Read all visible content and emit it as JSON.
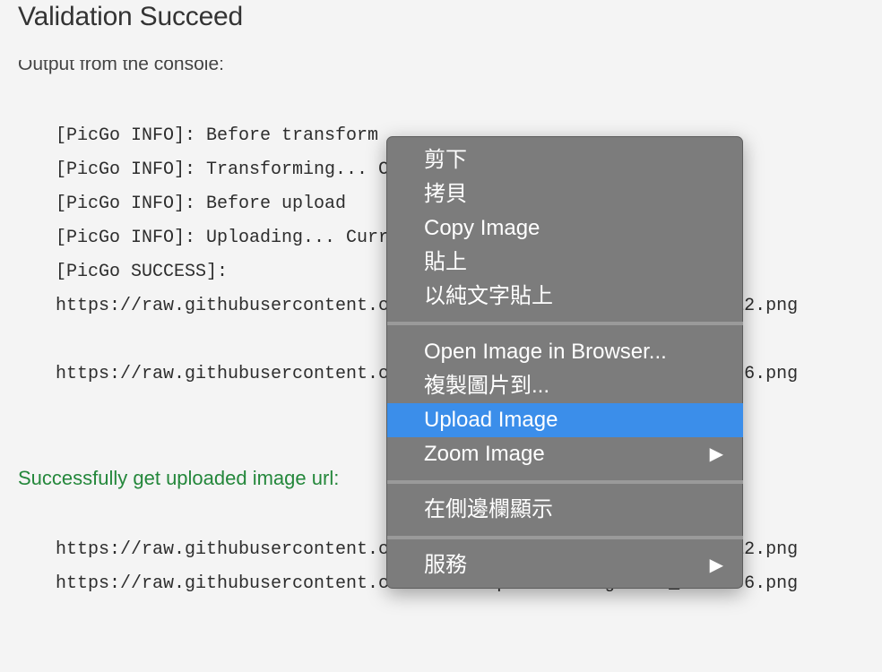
{
  "page": {
    "title": "Validation Succeed",
    "console_label": "Output from the console:",
    "console_lines": [
      "[PicGo INFO]: Before transform",
      "[PicGo INFO]: Transforming... Current transformer is [path]",
      "[PicGo INFO]: Before upload",
      "[PicGo INFO]: Uploading... Current uploader is [github]",
      "[PicGo SUCCESS]:",
      "https://raw.githubusercontent.com/user/repo/main/img/icon_512x512.png",
      "https://raw.githubusercontent.com/user/repo/main/img/icon_256x256.png"
    ],
    "success_message": "Successfully get uploaded image url:",
    "result_urls": [
      "https://raw.githubusercontent.com/user/repo/main/img/icon_512x512.png",
      "https://raw.githubusercontent.com/user/repo/main/img/icon_256x256.png"
    ]
  },
  "context_menu": {
    "items": [
      {
        "label": "剪下"
      },
      {
        "label": "拷貝"
      },
      {
        "label": "Copy Image"
      },
      {
        "label": "貼上"
      },
      {
        "label": "以純文字貼上"
      },
      {
        "label": "Open Image in Browser..."
      },
      {
        "label": "複製圖片到..."
      },
      {
        "label": "Upload Image",
        "highlighted": true
      },
      {
        "label": "Zoom Image",
        "submenu": true
      },
      {
        "label": "在側邊欄顯示"
      },
      {
        "label": "服務",
        "submenu": true
      }
    ],
    "submenu_arrow": "▶",
    "highlight_color": "#3b8eea",
    "background_color": "#7c7c7c"
  },
  "colors": {
    "success_text": "#24873b",
    "page_background": "#f4f4f4"
  }
}
